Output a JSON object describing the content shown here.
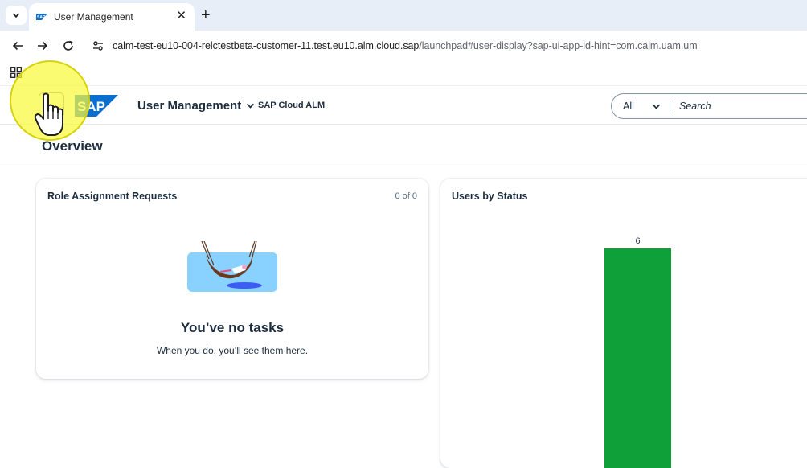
{
  "browser": {
    "tab_title": "User Management",
    "url_host": "calm-test-eu10-004-relctestbeta-customer-11.test.eu10.alm.cloud.sap",
    "url_path": "/launchpad#user-display?sap-ui-app-id-hint=com.calm.uam.um"
  },
  "shell": {
    "logo_text": "SAP",
    "app_title": "User Management",
    "app_subtitle": "SAP Cloud ALM",
    "search_scope": "All",
    "search_placeholder": "Search"
  },
  "page": {
    "title": "Overview"
  },
  "role_requests_card": {
    "title": "Role Assignment Requests",
    "count": "0 of 0",
    "empty_title": "You’ve no tasks",
    "empty_desc": "When you do, you’ll see them here."
  },
  "users_by_status_card": {
    "title": "Users by Status"
  },
  "chart_data": {
    "type": "bar",
    "title": "Users by Status",
    "categories": [
      ""
    ],
    "values": [
      6
    ],
    "data_labels": [
      "6"
    ],
    "colors": [
      "#0fa03a"
    ]
  },
  "colors": {
    "sap_blue": "#0a6ed1",
    "bar_green": "#0fa03a",
    "cursor_highlight": "#fafa3c"
  },
  "icons": [
    "chevron-down-icon",
    "sap-favicon",
    "close-icon",
    "plus-icon",
    "back-icon",
    "forward-icon",
    "reload-icon",
    "site-settings-icon",
    "apps-grid-icon",
    "home-icon",
    "hand-cursor-icon"
  ]
}
